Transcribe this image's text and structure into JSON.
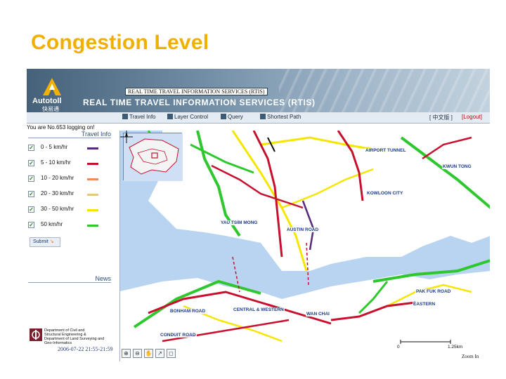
{
  "slide": {
    "title": "Congestion Level"
  },
  "banner": {
    "tag": "REAL TIME TRAVEL INFORMATION SERVICES (RTIS)",
    "logo_name": "Autotoll",
    "logo_cn": "快易通",
    "big_title": "REAL TIME TRAVEL INFORMATION SERVICES (RTIS)"
  },
  "toolbar": {
    "travel_info": "Travel Info",
    "layer_control": "Layer Control",
    "query": "Query",
    "shortest_path": "Shortest Path",
    "language": "[ 中文版 ]",
    "logout": "[Logout]"
  },
  "session": {
    "login_msg": "You are No.653 logging on!"
  },
  "left_panel": {
    "travel_info_header": "Travel Info",
    "legend": [
      {
        "label": "0 - 5 km/hr",
        "color": "#5a2a7a",
        "checked": "✓"
      },
      {
        "label": "5 - 10 km/hr",
        "color": "#c8102e",
        "checked": "✓"
      },
      {
        "label": "10 - 20 km/hr",
        "color": "#f08c5a",
        "checked": "✓"
      },
      {
        "label": "20 - 30 km/hr",
        "color": "#e6c87a",
        "checked": "✓"
      },
      {
        "label": "30 - 50 km/hr",
        "color": "#f5e600",
        "checked": "✓"
      },
      {
        "label": "50 km/hr",
        "color": "#2ec82e",
        "checked": "✓"
      }
    ],
    "submit_label": "Submit",
    "news_header": "News",
    "dept": "Department of Civil and\nStructural Engineering &\nDepartment of Land Surveying and\nGeo-Informatics",
    "timestamp": "2006-07-22 21:55-21:59"
  },
  "map": {
    "labels": {
      "kwun_tong": "KWUN TONG",
      "kowloon_city": "KOWLOON CITY",
      "yau_tsim_mong": "YAU TSIM MONG",
      "central_western": "CENTRAL & WESTERN",
      "wan_chai": "WAN CHAI",
      "eastern": "EASTERN",
      "airport_tunnel": "AIRPORT TUNNEL",
      "austin_road": "AUSTIN ROAD",
      "bonham_road": "BONHAM ROAD",
      "conduit_road": "CONDUIT ROAD",
      "pak_fuk_road": "PAK FUK ROAD"
    },
    "scale_start": "0",
    "scale_end": "1.25km",
    "zoom_label": "Zoom In"
  },
  "colors": {
    "title": "#f0b000",
    "water": "#b8d4f0",
    "land": "#ffffff",
    "road_red": "#c8102e",
    "road_green": "#2ec82e",
    "road_yellow": "#f5e600"
  }
}
